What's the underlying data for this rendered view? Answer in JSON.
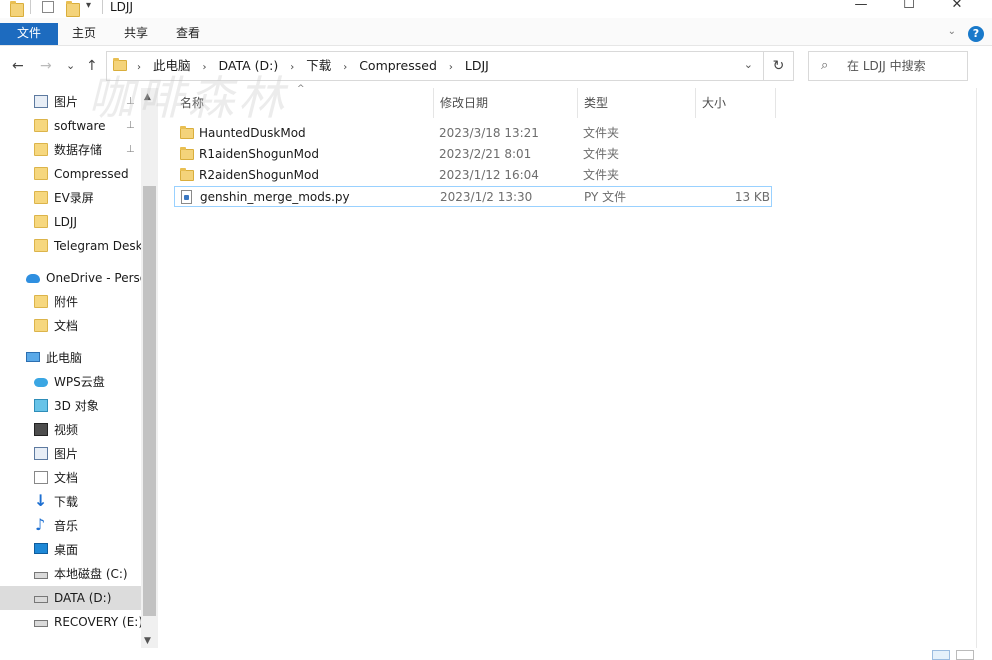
{
  "window": {
    "title": "LDJJ",
    "minimize": "—",
    "maximize": "☐",
    "close": "✕"
  },
  "ribbon": {
    "tabs": [
      "文件",
      "主页",
      "共享",
      "查看"
    ],
    "help": "?",
    "collapse": "⌄"
  },
  "nav": {
    "back": "←",
    "forward": "→",
    "recent": "⌄",
    "up": "↑",
    "refresh": "↻"
  },
  "address": {
    "crumbs": [
      "此电脑",
      "DATA (D:)",
      "下载",
      "Compressed",
      "LDJJ"
    ],
    "separator": "›",
    "dropdown": "⌄"
  },
  "search": {
    "icon": "⌕",
    "placeholder": "在 LDJJ 中搜索"
  },
  "sidebar": {
    "items": [
      {
        "label": "图片",
        "icon": "pictures-icon",
        "pinned": true
      },
      {
        "label": "software",
        "icon": "folder-icon",
        "pinned": true
      },
      {
        "label": "数据存储",
        "icon": "folder-icon",
        "pinned": true
      },
      {
        "label": "Compressed",
        "icon": "folder-icon",
        "pinned": false
      },
      {
        "label": "EV录屏",
        "icon": "folder-icon",
        "pinned": false
      },
      {
        "label": "LDJJ",
        "icon": "folder-icon",
        "pinned": false
      },
      {
        "label": "Telegram Desk",
        "icon": "folder-icon",
        "pinned": false
      },
      {
        "label": "OneDrive - Perso",
        "icon": "onedrive-icon",
        "pinned": false
      },
      {
        "label": "附件",
        "icon": "folder-icon",
        "pinned": false
      },
      {
        "label": "文档",
        "icon": "folder-icon",
        "pinned": false
      },
      {
        "label": "此电脑",
        "icon": "this-pc-icon",
        "pinned": false
      },
      {
        "label": "WPS云盘",
        "icon": "wps-cloud-icon",
        "pinned": false
      },
      {
        "label": "3D 对象",
        "icon": "3d-objects-icon",
        "pinned": false
      },
      {
        "label": "视频",
        "icon": "videos-icon",
        "pinned": false
      },
      {
        "label": "图片",
        "icon": "pictures-icon",
        "pinned": false
      },
      {
        "label": "文档",
        "icon": "documents-icon",
        "pinned": false
      },
      {
        "label": "下载",
        "icon": "downloads-icon",
        "pinned": false
      },
      {
        "label": "音乐",
        "icon": "music-icon",
        "pinned": false
      },
      {
        "label": "桌面",
        "icon": "desktop-icon",
        "pinned": false
      },
      {
        "label": "本地磁盘 (C:)",
        "icon": "drive-icon",
        "pinned": false
      },
      {
        "label": "DATA (D:)",
        "icon": "drive-icon",
        "pinned": false,
        "selected": true
      },
      {
        "label": "RECOVERY (E:)",
        "icon": "drive-icon",
        "pinned": false
      }
    ],
    "pin_glyph": "📌",
    "scroll_up": "▲",
    "scroll_down": "▼"
  },
  "columns": {
    "name": "名称",
    "date": "修改日期",
    "type": "类型",
    "size": "大小",
    "sort_glyph": "^"
  },
  "files": [
    {
      "name": "HauntedDuskMod",
      "date": "2023/3/18 13:21",
      "type": "文件夹",
      "size": "",
      "kind": "folder"
    },
    {
      "name": "R1aidenShogunMod",
      "date": "2023/2/21 8:01",
      "type": "文件夹",
      "size": "",
      "kind": "folder"
    },
    {
      "name": "R2aidenShogunMod",
      "date": "2023/1/12 16:04",
      "type": "文件夹",
      "size": "",
      "kind": "folder"
    },
    {
      "name": "genshin_merge_mods.py",
      "date": "2023/1/2 13:30",
      "type": "PY 文件",
      "size": "13 KB",
      "kind": "py",
      "selected": true
    }
  ],
  "watermark": "咖啡森林"
}
